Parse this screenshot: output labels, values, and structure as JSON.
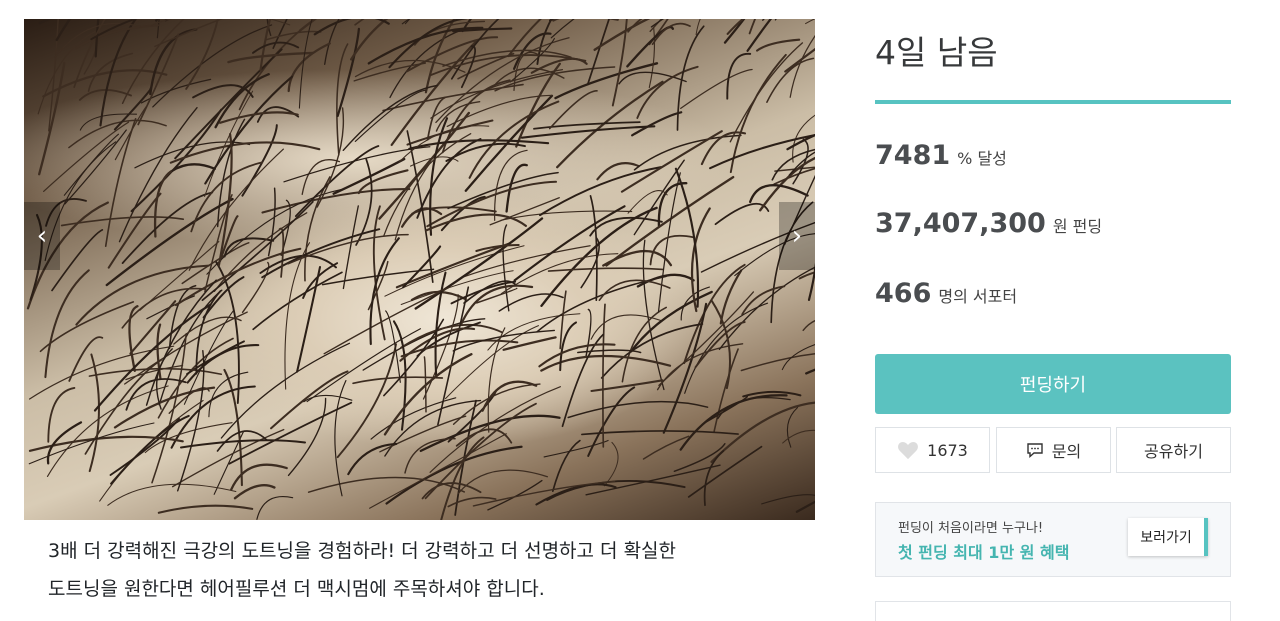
{
  "hero": {
    "image": "scalp-hair-closeup",
    "prev_icon": "‹",
    "next_icon": "›"
  },
  "intro": {
    "line1": "3배 더 강력해진 극강의 도트닝을 경험하라! 더 강력하고 더 선명하고 더 확실한",
    "line2": "도트닝을 원한다면 헤어필루션 더 맥시멈에 주목하셔야 합니다."
  },
  "campaign": {
    "days_left": "4일 남음",
    "progress_color": "#57c3c1",
    "achieved": {
      "value": "7481",
      "unit": "% 달성"
    },
    "funded": {
      "value": "37,407,300",
      "unit": "원 펀딩"
    },
    "supporters": {
      "value": "466",
      "unit": "명의 서포터"
    }
  },
  "actions": {
    "fund_label": "펀딩하기",
    "like_count": "1673",
    "like_icon": "heart-icon",
    "inquiry_label": "문의",
    "inquiry_icon": "chat-icon",
    "share_label": "공유하기"
  },
  "promo": {
    "subtitle": "펀딩이 처음이라면 누구나!",
    "title": "첫 펀딩 최대 1만 원 혜택",
    "button_label": "보러가기"
  },
  "colors": {
    "accent": "#5bc2c0",
    "promo_text": "#45b5b0"
  }
}
